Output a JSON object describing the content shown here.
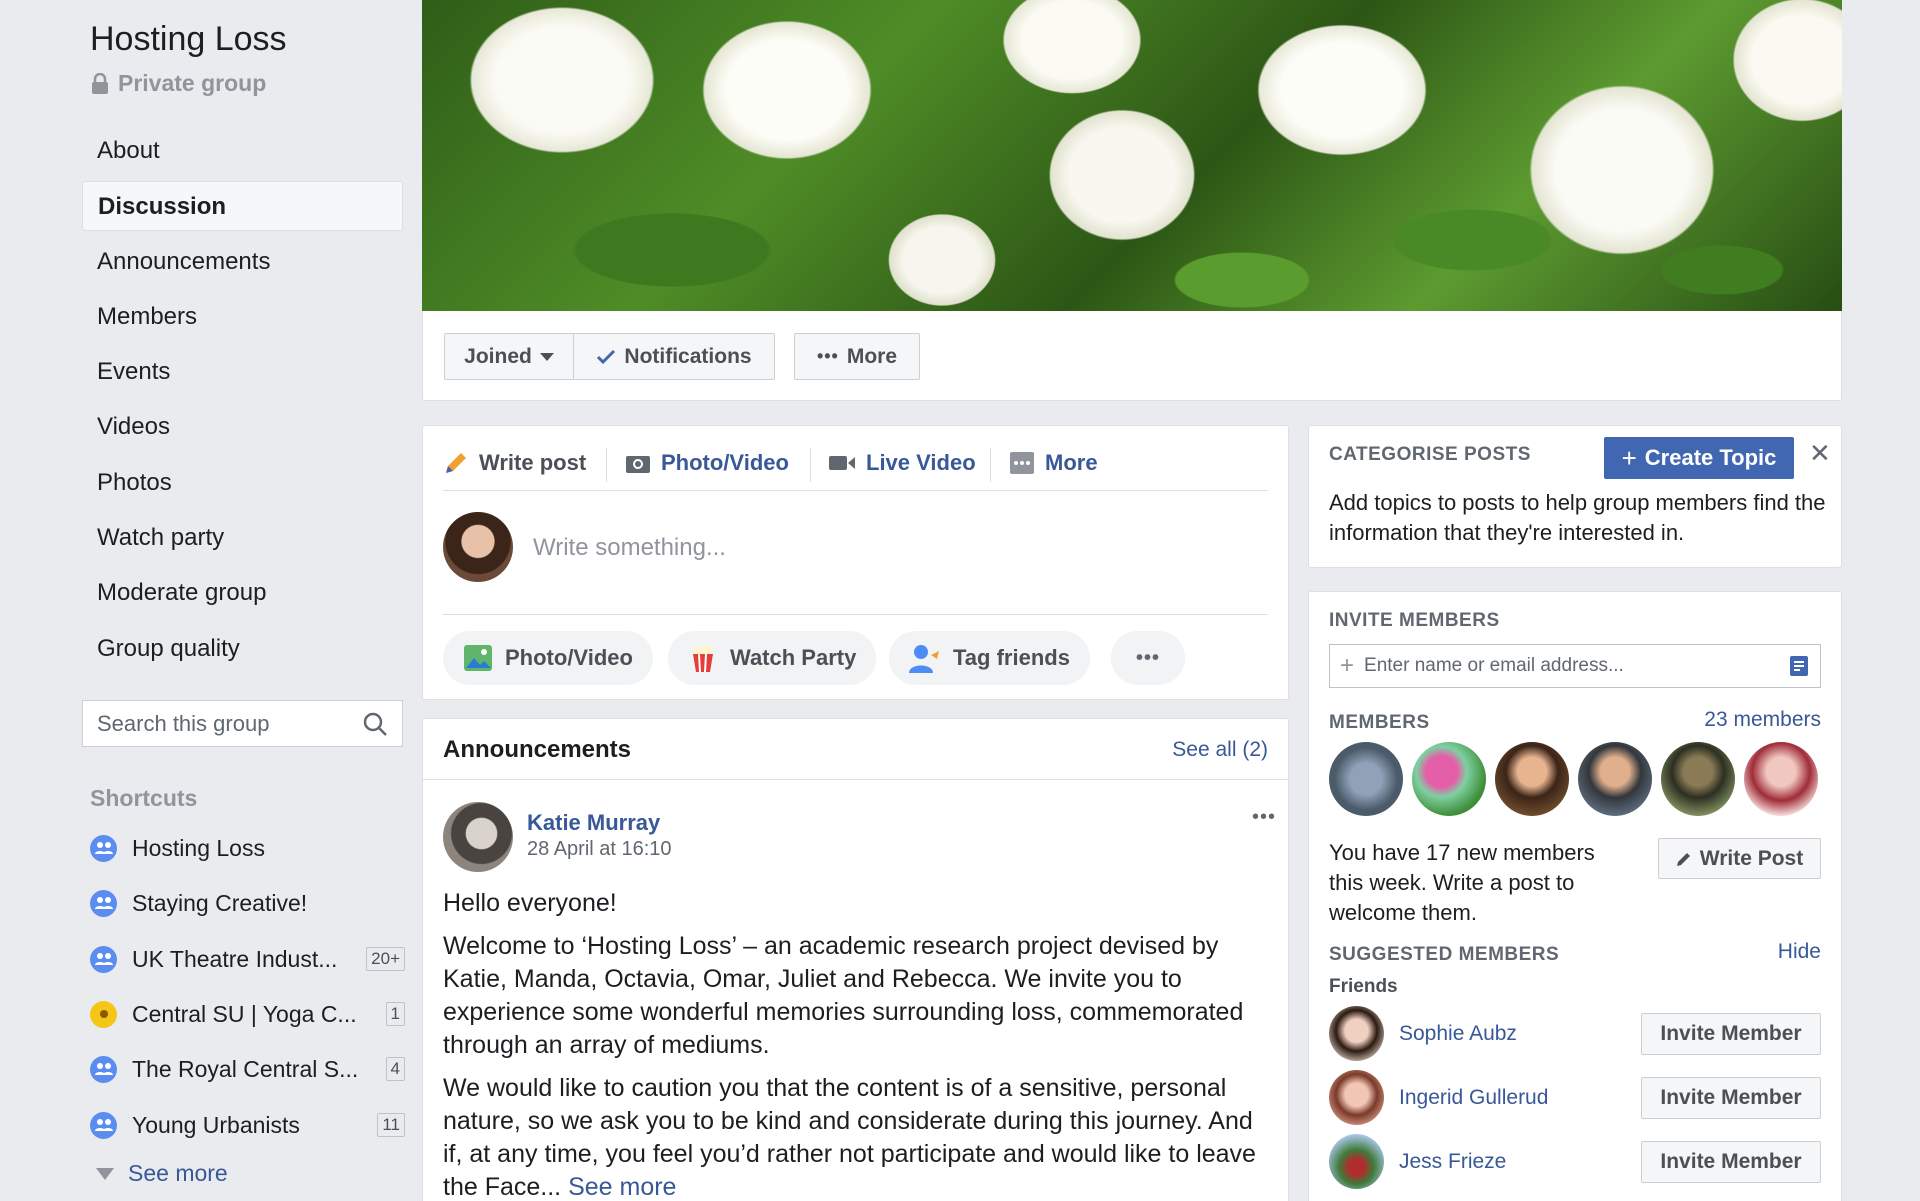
{
  "sidebar": {
    "group_name": "Hosting Loss",
    "privacy": "Private group",
    "nav": [
      {
        "label": "About"
      },
      {
        "label": "Discussion"
      },
      {
        "label": "Announcements"
      },
      {
        "label": "Members"
      },
      {
        "label": "Events"
      },
      {
        "label": "Videos"
      },
      {
        "label": "Photos"
      },
      {
        "label": "Watch party"
      },
      {
        "label": "Moderate group"
      },
      {
        "label": "Group quality"
      }
    ],
    "active_nav": "Discussion",
    "search_placeholder": "Search this group",
    "shortcuts_label": "Shortcuts",
    "shortcuts": [
      {
        "label": "Hosting Loss",
        "badge": ""
      },
      {
        "label": "Staying Creative!",
        "badge": ""
      },
      {
        "label": "UK Theatre Indust...",
        "badge": "20+"
      },
      {
        "label": "Central SU | Yoga C...",
        "badge": "1"
      },
      {
        "label": "The Royal Central S...",
        "badge": "4"
      },
      {
        "label": "Young Urbanists",
        "badge": "11"
      }
    ],
    "see_more": "See more"
  },
  "actions": {
    "joined": "Joined",
    "notifications": "Notifications",
    "more": "More"
  },
  "composer": {
    "tabs": {
      "write_post": "Write post",
      "photo_video": "Photo/Video",
      "live_video": "Live Video",
      "more": "More"
    },
    "placeholder": "Write something...",
    "pills": {
      "photo_video": "Photo/Video",
      "watch_party": "Watch Party",
      "tag_friends": "Tag friends"
    }
  },
  "announcements": {
    "title": "Announcements",
    "see_all": "See all (2)",
    "post": {
      "author": "Katie Murray",
      "timestamp": "28 April at 16:10",
      "p1": "Hello everyone!",
      "p2": "Welcome to ‘Hosting Loss’ – an academic research project devised by Katie, Manda, Octavia, Omar, Juliet and Rebecca. We invite you to experience some wonderful memories surrounding loss, commemorated through an array of mediums.",
      "p3": "We would like to caution you that the content is of a sensitive, personal nature, so we ask you to be kind and considerate during this journey. And if, at any time, you feel you’d rather not participate and would like to leave the Face...",
      "see_more": "See more"
    }
  },
  "categorise": {
    "label": "CATEGORISE POSTS",
    "create_topic": "Create Topic",
    "description": "Add topics to posts to help group members find the information that they're interested in."
  },
  "invite": {
    "label": "INVITE MEMBERS",
    "input_placeholder": "Enter name or email address...",
    "members_label": "MEMBERS",
    "members_count": "23 members",
    "new_members_text": "You have 17 new members this week. Write a post to welcome them.",
    "write_post": "Write Post",
    "suggested_label": "SUGGESTED MEMBERS",
    "hide": "Hide",
    "friends_label": "Friends",
    "suggested": [
      {
        "name": "Sophie Aubz",
        "button": "Invite Member"
      },
      {
        "name": "Ingerid Gullerud",
        "button": "Invite Member"
      },
      {
        "name": "Jess Frieze",
        "button": "Invite Member"
      }
    ]
  },
  "colors": {
    "brand_blue": "#4267b2",
    "link_blue": "#385898",
    "page_bg": "#e9ebee"
  }
}
